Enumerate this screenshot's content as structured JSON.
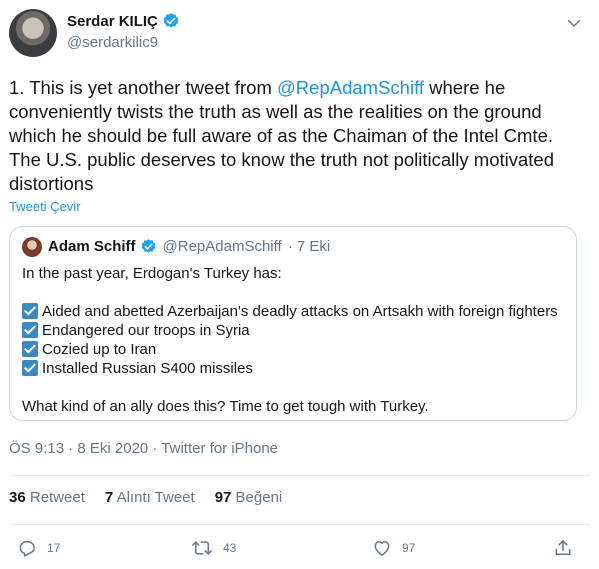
{
  "author": {
    "name": "Serdar KILIÇ",
    "handle": "@serdarkilic9"
  },
  "tweet": {
    "prefix": "1. This is yet another tweet from ",
    "mention": "@RepAdamSchiff",
    "rest": " where he conveniently twists the truth as well as the realities on the ground which he should be full aware of as the Chaiman of the Intel Cmte. The U.S. public deserves to know the truth not politically motivated distortions",
    "translate_label": "Tweeti Çevir"
  },
  "quoted": {
    "name": "Adam Schiff",
    "handle": "@RepAdamSchiff",
    "date": "· 7 Eki",
    "intro": "In the past year, Erdogan's Turkey has:",
    "items": [
      "Aided and abetted Azerbaijan's deadly attacks on Artsakh with foreign fighters",
      "Endangered our troops in Syria",
      "Cozied up to Iran",
      "Installed Russian S400 missiles"
    ],
    "closing": "What kind of an ally does this? Time to get tough with Turkey."
  },
  "timestamp": "ÖS 9:13 · 8 Eki 2020 · Twitter for iPhone",
  "stats": {
    "retweets_count": "36",
    "retweets_label": "Retweet",
    "quotes_count": "7",
    "quotes_label": "Alıntı Tweet",
    "likes_count": "97",
    "likes_label": "Beğeni"
  },
  "actions": {
    "reply_count": "17",
    "retweet_count": "43",
    "like_count": "97"
  },
  "colors": {
    "link": "#1b95e0",
    "verified": "#1da1f2",
    "secondary_text": "#657786",
    "checkbox": "#3b88c3"
  }
}
